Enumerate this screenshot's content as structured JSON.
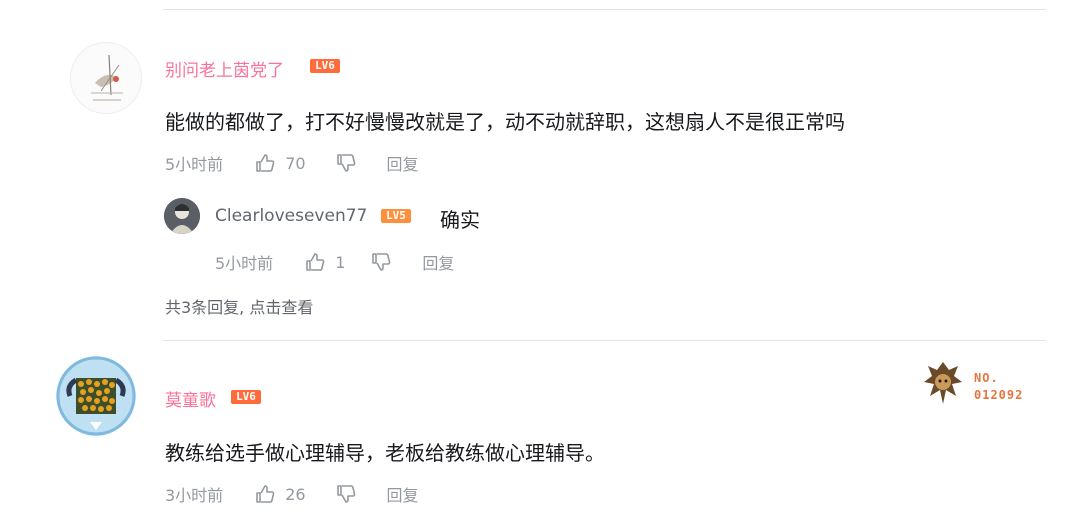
{
  "comments": [
    {
      "username": "别问老上茵党了",
      "level": "LV6",
      "text": "能做的都做了，打不好慢慢改就是了，动不动就辞职，这想扇人不是很正常吗",
      "time": "5小时前",
      "likes": "70",
      "reply_label": "回复",
      "replies": [
        {
          "username": "Clearloveseven77",
          "level": "LV5",
          "text": "确实",
          "time": "5小时前",
          "likes": "1",
          "reply_label": "回复"
        }
      ],
      "more_replies": "共3条回复, 点击查看"
    },
    {
      "username": "莫童歌",
      "level": "LV6",
      "text": "教练给选手做心理辅导，老板给教练做心理辅导。",
      "time": "3小时前",
      "likes": "26",
      "reply_label": "回复",
      "badge": {
        "line1": "NO.",
        "line2": "012092"
      }
    }
  ],
  "colors": {
    "username": "#fb7299",
    "level_badge": "#ff6b3b",
    "meta_text": "#9499a0"
  },
  "icons": [
    "thumbs-up-icon",
    "thumbs-down-icon"
  ]
}
